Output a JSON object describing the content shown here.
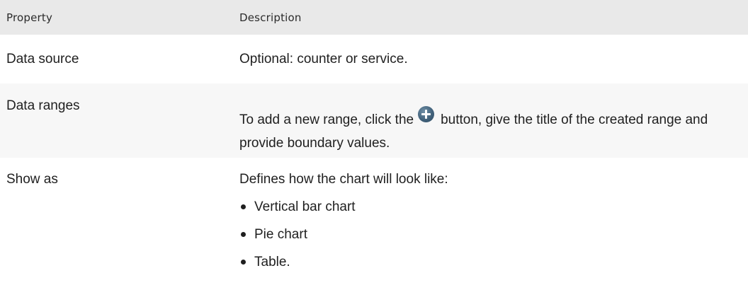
{
  "table": {
    "headers": {
      "property": "Property",
      "description": "Description"
    },
    "rows": {
      "data_source": {
        "property": "Data source",
        "description": "Optional: counter or service."
      },
      "data_ranges": {
        "property": "Data ranges",
        "description_before": "To add a new range, click the",
        "icon": "add-circle-icon",
        "description_after": "button, give the title of the created range and provide boundary values."
      },
      "show_as": {
        "property": "Show as",
        "intro": "Defines how the chart will look like:",
        "options": [
          "Vertical bar chart",
          "Pie chart",
          "Table."
        ]
      }
    }
  }
}
